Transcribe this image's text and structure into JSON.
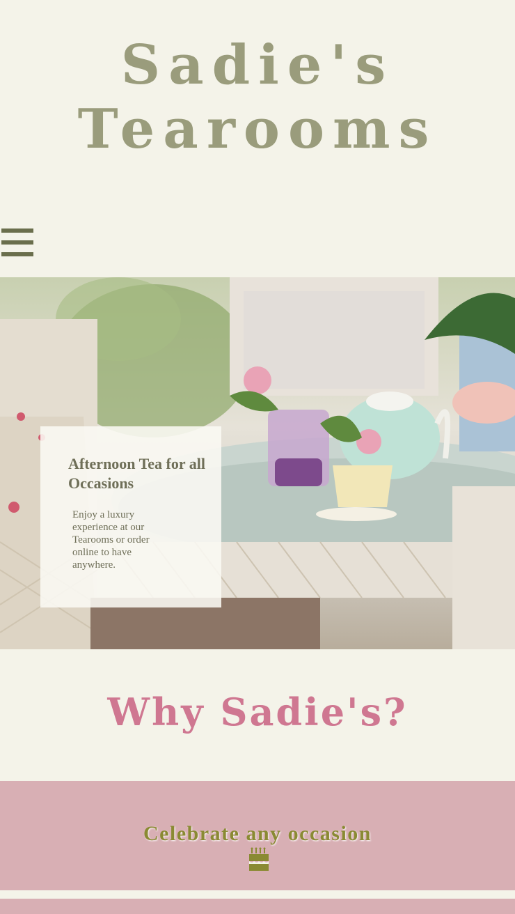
{
  "header": {
    "title_line1": "Sadie's",
    "title_line2": "Tearooms"
  },
  "nav": {
    "menu_icon": "hamburger-menu-icon"
  },
  "hero": {
    "image": "afternoon-tea-table-photo",
    "heading": "Afternoon Tea for all Occasions",
    "text": "Enjoy a luxury experience at our Tearooms or order online to have anywhere."
  },
  "why": {
    "heading": "Why Sadie's?"
  },
  "features": [
    {
      "heading": "Celebrate any occasion",
      "icon": "birthday-cake-icon"
    }
  ],
  "colors": {
    "background": "#f4f3e9",
    "title": "#9a9c7c",
    "accent_pink": "#cf7791",
    "band_pink": "#d8afb4",
    "olive": "#8a8a33",
    "menu": "#6a6e4c"
  }
}
